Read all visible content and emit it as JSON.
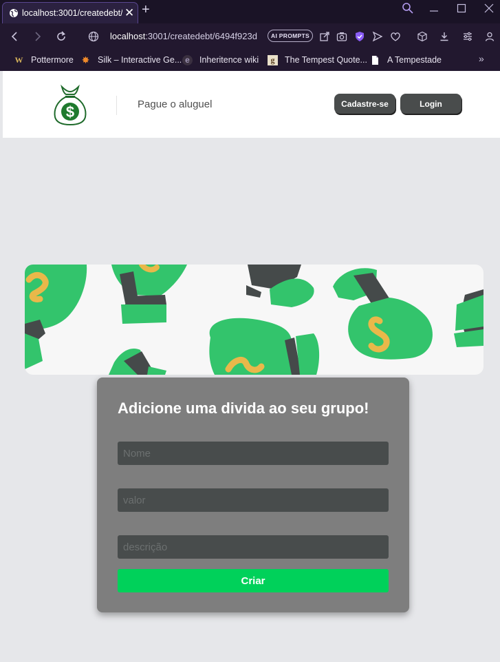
{
  "browser": {
    "tab": {
      "title": "localhost:3001/createdebt/",
      "close_glyph": "✕"
    },
    "new_tab_glyph": "+",
    "address": {
      "host": "localhost",
      "path": ":3001/createdebt/6494f923d"
    },
    "ai_prompts_label": "AI PROMPTS",
    "bookmarks": [
      {
        "label": "Pottermore",
        "icon": "W"
      },
      {
        "label": "Silk – Interactive Ge...",
        "icon": "✸"
      },
      {
        "label": "Inheritence wiki",
        "icon": "e"
      },
      {
        "label": "The Tempest Quote...",
        "icon": "g"
      },
      {
        "label": "A Tempestade",
        "icon": "doc"
      }
    ],
    "bookmarks_more": "»"
  },
  "header": {
    "nav_link": "Pague o aluguel",
    "signup_label": "Cadastre-se",
    "login_label": "Login"
  },
  "form": {
    "title": "Adicione uma divida ao seu grupo!",
    "name_placeholder": "Nome",
    "value_placeholder": "valor",
    "description_placeholder": "descrição",
    "submit_label": "Criar"
  },
  "colors": {
    "browser_frame": "#1a1326",
    "page_background": "#e6e7ea",
    "card_background": "#7e7e7e",
    "field_background": "#484c4c",
    "submit_green": "#00d15a",
    "money_bag_green": "#33c46c",
    "coin_gold": "#e9b84a"
  }
}
